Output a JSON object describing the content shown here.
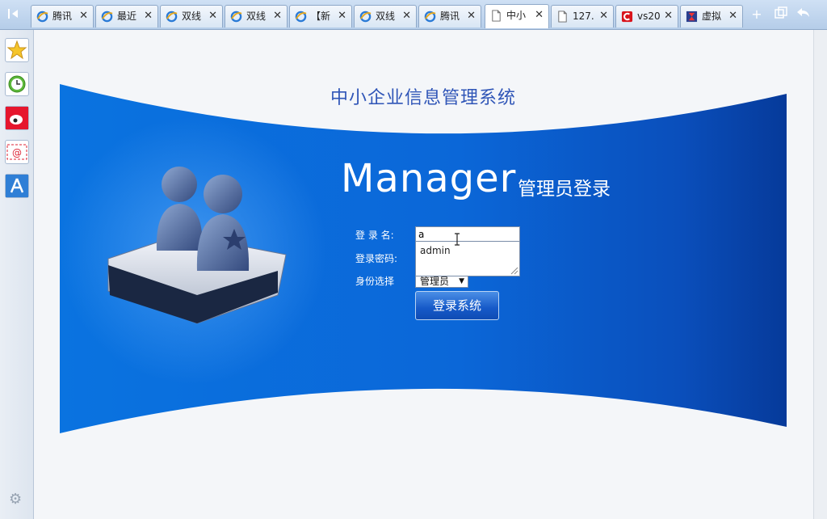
{
  "browser": {
    "tabs": [
      {
        "label": "腾讯",
        "icon": "ie-icon",
        "active": false
      },
      {
        "label": "最近",
        "icon": "ie-icon",
        "active": false
      },
      {
        "label": "双线",
        "icon": "ie-icon",
        "active": false
      },
      {
        "label": "双线",
        "icon": "ie-icon",
        "active": false
      },
      {
        "label": "【新",
        "icon": "ie-icon",
        "active": false
      },
      {
        "label": "双线",
        "icon": "ie-icon",
        "active": false
      },
      {
        "label": "腾讯",
        "icon": "ie-icon",
        "active": false
      },
      {
        "label": "中小",
        "icon": "page-icon",
        "active": true
      },
      {
        "label": "127.",
        "icon": "page-icon",
        "active": false
      },
      {
        "label": "vs20",
        "icon": "red-c-icon",
        "active": false
      },
      {
        "label": "虚拟",
        "icon": "hourglass-icon",
        "active": false
      }
    ],
    "sidebar": [
      "star-icon",
      "clock-icon",
      "weibo-icon",
      "mail-icon",
      "qq-icon"
    ],
    "colors": {
      "tabbar": "#b5cde9",
      "accent": "#0a5fd6"
    }
  },
  "page": {
    "title": "中小企业信息管理系统",
    "brand": "Manager",
    "subtitle": "管理员登录",
    "form": {
      "username_label": "登 录 名:",
      "password_label": "登录密码:",
      "role_label": "身份选择",
      "username_value": "a",
      "autocomplete_option": "admin",
      "role_value": "管理员",
      "submit": "登录系统"
    }
  }
}
